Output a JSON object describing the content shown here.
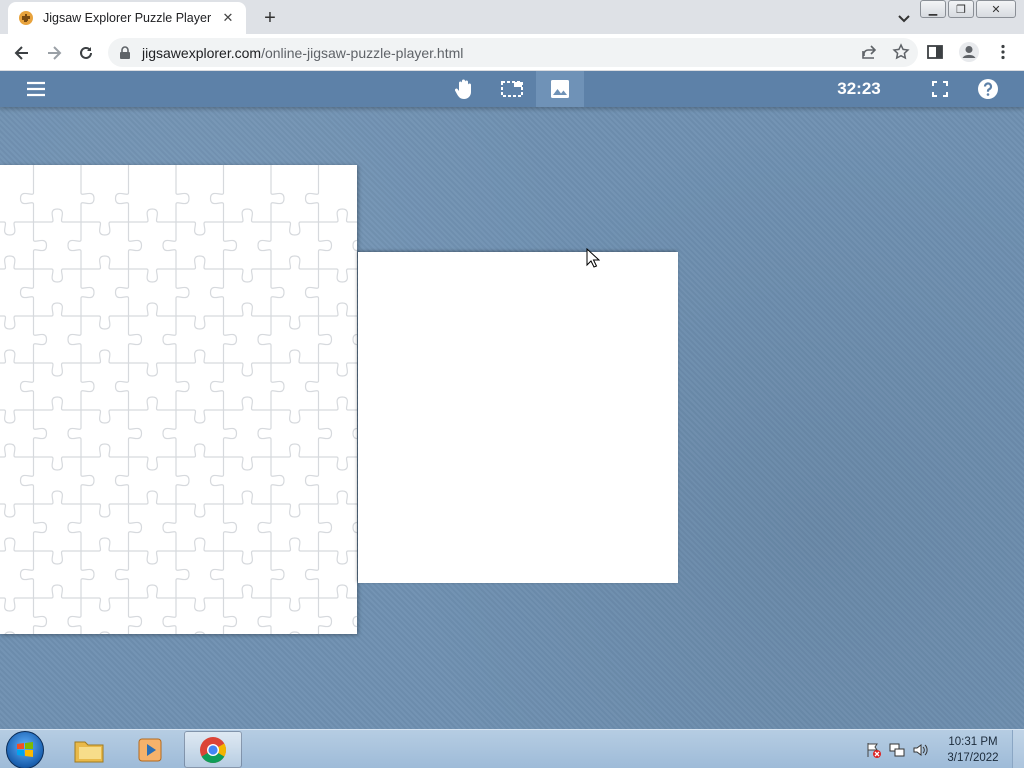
{
  "browser": {
    "tab_title": "Jigsaw Explorer Puzzle Player",
    "url_domain": "jigsawexplorer.com",
    "url_path": "/online-jigsaw-puzzle-player.html"
  },
  "app": {
    "timer": "32:23",
    "icons": [
      "menu-icon",
      "hand-icon",
      "selection-icon",
      "image-icon",
      "fullscreen-icon",
      "help-icon"
    ]
  },
  "taskbar": {
    "time": "10:31 PM",
    "date": "3/17/2022",
    "items": [
      "start-orb",
      "file-explorer",
      "media-player",
      "chrome"
    ]
  },
  "colors": {
    "appbar": "#5d81a8",
    "background": "#6f91b2",
    "puzzle": "#ffffff"
  }
}
